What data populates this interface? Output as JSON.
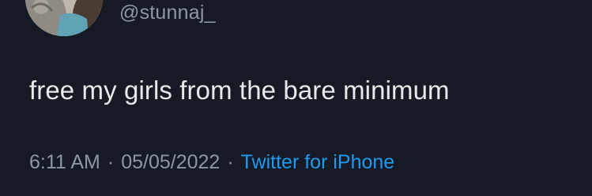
{
  "tweet": {
    "handle": "@stunnaj_",
    "text": "free my girls from the bare minimum",
    "time": "6:11 AM",
    "date": "05/05/2022",
    "separator": "·",
    "source": "Twitter for iPhone"
  },
  "colors": {
    "background": "#151a25",
    "text": "#e7e9ea",
    "muted": "#8b98a5",
    "link": "#1d9bf0"
  }
}
